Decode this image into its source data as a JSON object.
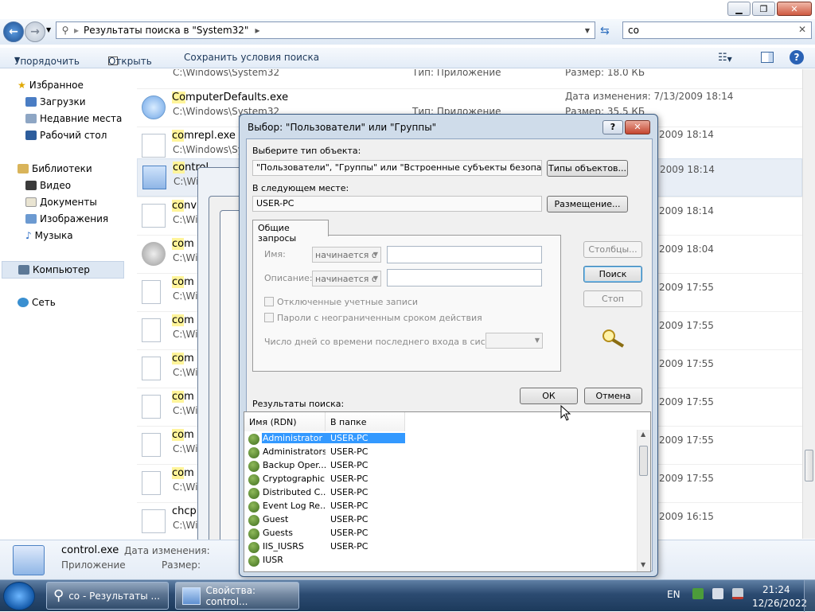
{
  "explorer": {
    "address": "Результаты поиска в \"System32\"",
    "search_value": "co",
    "toolbar": {
      "organize": "Упорядочить",
      "open": "Открыть",
      "save_search": "Сохранить условия поиска"
    },
    "nav": {
      "favorites": "Избранное",
      "downloads": "Загрузки",
      "recent": "Недавние места",
      "desktop": "Рабочий стол",
      "libraries": "Библиотеки",
      "video": "Видео",
      "documents": "Документы",
      "pictures": "Изображения",
      "music": "Музыка",
      "computer": "Компьютер",
      "network": "Сеть"
    },
    "files": [
      {
        "name_hl": "",
        "name_rest": "",
        "path": "C:\\Windows\\System32",
        "type": "Тип: Приложение",
        "meta": "Размер: 18.0 КБ"
      },
      {
        "name_hl": "Co",
        "name_rest": "mputerDefaults.exe",
        "path": "C:\\Windows\\System32",
        "type": "Тип: Приложение",
        "date": "Дата изменения: 7/13/2009 18:14",
        "size": "Размер: 35.5 КБ"
      },
      {
        "name_hl": "co",
        "name_rest": "mrepl.exe",
        "path": "C:\\Windows\\Sys",
        "date": "2009 18:14"
      },
      {
        "name_hl": "co",
        "name_rest": "ntrol",
        "path": "C:\\Wi",
        "date": "2009 18:14"
      },
      {
        "name_hl": "co",
        "name_rest": "nv",
        "path": "C:\\Wi",
        "date": "2009 18:14"
      },
      {
        "name_hl": "co",
        "name_rest": "m",
        "path": "C:\\Wi",
        "date": "2009 18:04"
      },
      {
        "name_hl": "co",
        "name_rest": "m",
        "path": "C:\\Wi",
        "date": "2009 17:55"
      },
      {
        "name_hl": "co",
        "name_rest": "m",
        "path": "C:\\Wi",
        "date": "2009 17:55"
      },
      {
        "name_hl": "co",
        "name_rest": "m",
        "path": "C:\\Wi",
        "date": "2009 17:55"
      },
      {
        "name_hl": "co",
        "name_rest": "m",
        "path": "C:\\Wi",
        "date": "2009 17:55"
      },
      {
        "name_hl": "co",
        "name_rest": "m",
        "path": "C:\\Wi",
        "date": "2009 17:55"
      },
      {
        "name_hl": "co",
        "name_rest": "m",
        "path": "C:\\Wi",
        "date": "2009 17:55"
      },
      {
        "name_hl": "",
        "name_rest": "chcp",
        "path": "C:\\Wi",
        "date": "2009 16:15"
      }
    ],
    "details": {
      "name": "control.exe",
      "type": "Приложение",
      "date_label": "Дата изменения:",
      "size_label": "Размер:"
    }
  },
  "dialog": {
    "title": "Выбор: \"Пользователи\" или \"Группы\"",
    "help": "?",
    "object_type_label": "Выберите тип объекта:",
    "object_type_value": "\"Пользователи\", \"Группы\" или \"Встроенные субъекты безопасности\"",
    "object_types_button": "Типы объектов...",
    "location_label": "В следующем месте:",
    "location_value": "USER-PC",
    "locations_button": "Размещение...",
    "tab_common": "Общие запросы",
    "name_label": "Имя:",
    "name_combo": "начинается с",
    "desc_label": "Описание:",
    "desc_combo": "начинается с",
    "disabled_accounts": "Отключенные учетные записи",
    "non_expiring": "Пароли с неограниченным сроком действия",
    "days_label": "Число дней со времени последнего входа в систему:",
    "columns_button": "Столбцы...",
    "find_button": "Поиск",
    "stop_button": "Стоп",
    "ok_button": "ОК",
    "cancel_button": "Отмена",
    "results_label": "Результаты поиска:",
    "col_name": "Имя (RDN)",
    "col_folder": "В папке",
    "results": [
      {
        "name": "Administrator",
        "folder": "USER-PC"
      },
      {
        "name": "Administrators",
        "folder": "USER-PC"
      },
      {
        "name": "Backup Oper...",
        "folder": "USER-PC"
      },
      {
        "name": "Cryptographic...",
        "folder": "USER-PC"
      },
      {
        "name": "Distributed C...",
        "folder": "USER-PC"
      },
      {
        "name": "Event Log Re...",
        "folder": "USER-PC"
      },
      {
        "name": "Guest",
        "folder": "USER-PC"
      },
      {
        "name": "Guests",
        "folder": "USER-PC"
      },
      {
        "name": "IIS_IUSRS",
        "folder": "USER-PC"
      },
      {
        "name": "IUSR",
        "folder": ""
      }
    ]
  },
  "taskbar": {
    "item1": "co - Результаты ...",
    "item2": "Свойства: control...",
    "lang": "EN",
    "time": "21:24",
    "date": "12/26/2022"
  }
}
